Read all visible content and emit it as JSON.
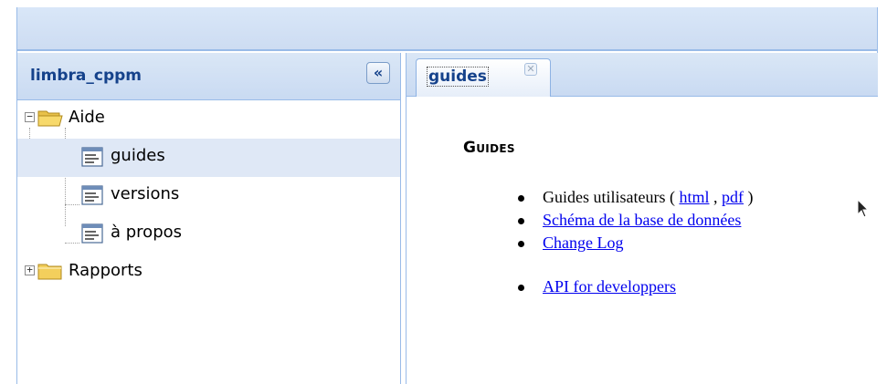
{
  "west_panel": {
    "title": "limbra_cppm",
    "collapse_glyph": "«",
    "tree": {
      "aide": {
        "label": "Aide",
        "expanded": true,
        "expander": "−"
      },
      "children": [
        {
          "label": "guides",
          "selected": true
        },
        {
          "label": "versions",
          "selected": false
        },
        {
          "label": "à propos",
          "selected": false
        }
      ],
      "rapports": {
        "label": "Rapports",
        "expanded": false,
        "expander": "+"
      }
    }
  },
  "tabs": [
    {
      "label": "guides",
      "active": true,
      "close_glyph": "✕"
    }
  ],
  "guides_page": {
    "heading": "Guides",
    "item1_prefix": "Guides utilisateurs ( ",
    "item1_link_html": "html",
    "item1_sep": " , ",
    "item1_link_pdf": "pdf",
    "item1_suffix": " )",
    "item2_link": "Schéma de la base de données",
    "item3_link": "Change Log",
    "item4_link": "API for developpers"
  },
  "colors": {
    "header_text": "#15428b",
    "panel_border": "#99bbe8",
    "selection": "#dfe8f6",
    "link": "#0000ee"
  }
}
